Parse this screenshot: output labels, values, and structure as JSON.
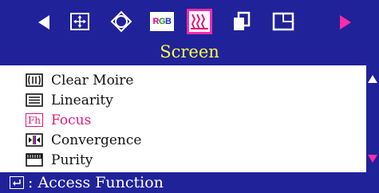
{
  "toolbar": {
    "icons": [
      "left-arrow-icon",
      "image-size-icon",
      "geometry-position-icon",
      "rgb-color-icon",
      "screen-icon",
      "copy-windows-icon",
      "window-frame-icon",
      "right-arrow-icon"
    ],
    "rgb_label": "RGB",
    "selected": "screen-icon"
  },
  "title": "Screen",
  "menu": {
    "items": [
      {
        "label": "Clear Moire",
        "icon": "moire-icon",
        "active": false
      },
      {
        "label": "Linearity",
        "icon": "linearity-icon",
        "active": false
      },
      {
        "label": "Focus",
        "icon": "focus-icon",
        "icon_text": "Fh",
        "active": true
      },
      {
        "label": "Convergence",
        "icon": "convergence-icon",
        "active": false
      },
      {
        "label": "Purity",
        "icon": "purity-icon",
        "active": false
      }
    ]
  },
  "footer": {
    "label": ": Access Function",
    "icon": "enter-icon"
  },
  "colors": {
    "background": "#20229a",
    "title": "#ffff40",
    "highlight": "#e0187a",
    "panel": "#ffffff"
  }
}
